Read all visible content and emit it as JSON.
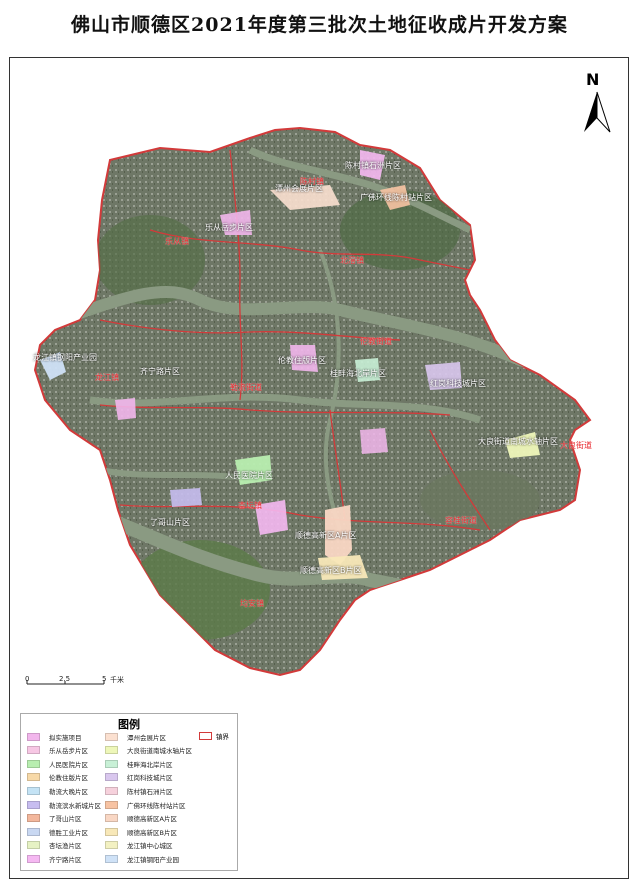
{
  "title": "佛山市顺德区2021年度第三批次土地征收成片开发方案",
  "north": "N",
  "scale": {
    "start": "0",
    "mid": "2.5",
    "end": "5",
    "unit": "千米"
  },
  "legend": {
    "title": "图例",
    "town_boundary": "镇界",
    "items": [
      {
        "label": "拟实施项目",
        "color": "#f2b6ec"
      },
      {
        "label": "乐从岳步片区",
        "color": "#f7c7e4"
      },
      {
        "label": "人民医院片区",
        "color": "#b8eeb0"
      },
      {
        "label": "伦教住版片区",
        "color": "#f7d9a8"
      },
      {
        "label": "勒流大晚片区",
        "color": "#c4e3f5"
      },
      {
        "label": "勒流滨水新城片区",
        "color": "#c7bdf0"
      },
      {
        "label": "了哥山片区",
        "color": "#f3b79c"
      },
      {
        "label": "德胜工业片区",
        "color": "#c9d8f2"
      },
      {
        "label": "杏坛渔片区",
        "color": "#e6f2c4"
      },
      {
        "label": "齐宁路片区",
        "color": "#f5b8f2"
      },
      {
        "label": "潭州会展片区",
        "color": "#fbe0d0"
      },
      {
        "label": "大良街道南城水轴片区",
        "color": "#eef7b9"
      },
      {
        "label": "桂畔海北岸片区",
        "color": "#c8f0d6"
      },
      {
        "label": "红岗科技城片区",
        "color": "#d9c7ee"
      },
      {
        "label": "陈村镇石洲片区",
        "color": "#f6d1dc"
      },
      {
        "label": "广佛环线陈村站片区",
        "color": "#f7c3a3"
      },
      {
        "label": "顺德高新区A片区",
        "color": "#f9d7c4"
      },
      {
        "label": "顺德高新区B片区",
        "color": "#f8e8b8"
      },
      {
        "label": "龙江镇中心城区",
        "color": "#f3f1c2"
      },
      {
        "label": "龙江镇钢阳产业园",
        "color": "#cfe2f7"
      }
    ]
  },
  "map_labels": [
    "潭州会展片区",
    "陈村镇石洲片区",
    "广佛环线陈村站片区",
    "乐从岳步片区",
    "龙江镇钢阳产业园",
    "齐宁路片区",
    "伦教住版片区",
    "红岗科技城片区",
    "桂畔海北岸片区",
    "大良街道南城水轴片区",
    "人民医院片区",
    "了哥山片区",
    "顺德高新区A片区",
    "顺德高新区B片区"
  ],
  "town_labels": [
    "陈村镇",
    "乐从镇",
    "北滘镇",
    "龙江镇",
    "勒流街道",
    "伦教街道",
    "大良街道",
    "容桂街道",
    "杏坛镇",
    "均安镇"
  ],
  "colors": {
    "town_boundary": "#d23a3a",
    "river": "#8a9a82",
    "land": "#5f6f52"
  }
}
